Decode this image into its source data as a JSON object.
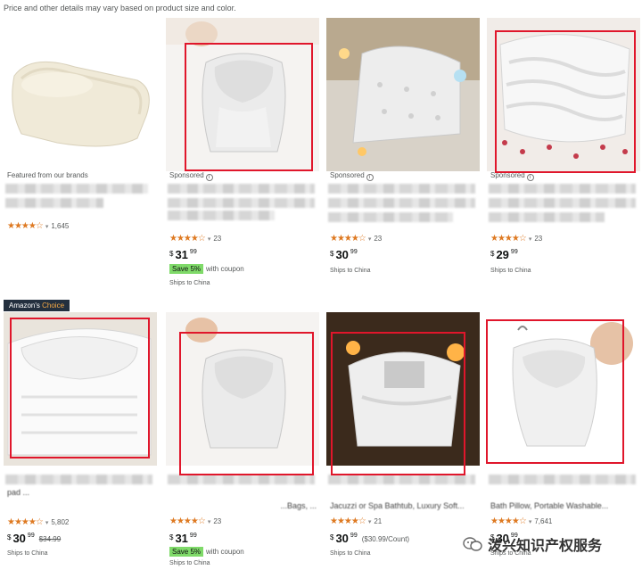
{
  "disclaimer": "Price and other details may vary based on product size and color.",
  "badge": {
    "prefix": "Amazon's",
    "accent": "Choice"
  },
  "star_glyphs": "★★★★☆",
  "caret": "▾",
  "watermark": "泼兴知识产权服务",
  "products": [
    {
      "label": "Featured from our brands",
      "rating": 4.5,
      "count": "1,645"
    },
    {
      "label": "Sponsored",
      "rating": 4.5,
      "count": "23",
      "price_whole": "31",
      "price_frac": "99",
      "coupon_tag": "Save 5%",
      "coupon_text": "with coupon",
      "ships": "Ships to China"
    },
    {
      "label": "Sponsored",
      "rating": 4.5,
      "count": "23",
      "price_whole": "30",
      "price_frac": "99",
      "ships": "Ships to China"
    },
    {
      "label": "Sponsored",
      "rating": 4.5,
      "count": "23",
      "price_whole": "29",
      "price_frac": "99",
      "ships": "Ships to China"
    },
    {
      "title_tail": "pad ...",
      "rating": 4.5,
      "count": "5,802",
      "price_whole": "30",
      "price_frac": "99",
      "list_price": "$34.99",
      "ships": "Ships to China"
    },
    {
      "title_tail": "...Bags, ...",
      "rating": 4.5,
      "count": "23",
      "price_whole": "31",
      "price_frac": "99",
      "coupon_tag": "Save 5%",
      "coupon_text": "with coupon",
      "ships": "Ships to China"
    },
    {
      "title_tail": "Jacuzzi or Spa Bathtub, Luxury Soft...",
      "rating": 4.5,
      "count": "21",
      "price_whole": "30",
      "price_frac": "99",
      "unit_price": "($30.99/Count)",
      "ships": "Ships to China"
    },
    {
      "title_tail": "Bath Pillow, Portable Washable...",
      "rating": 4.5,
      "count": "7,641",
      "price_whole": "30",
      "price_frac": "99",
      "ships": "Ships to China"
    }
  ]
}
